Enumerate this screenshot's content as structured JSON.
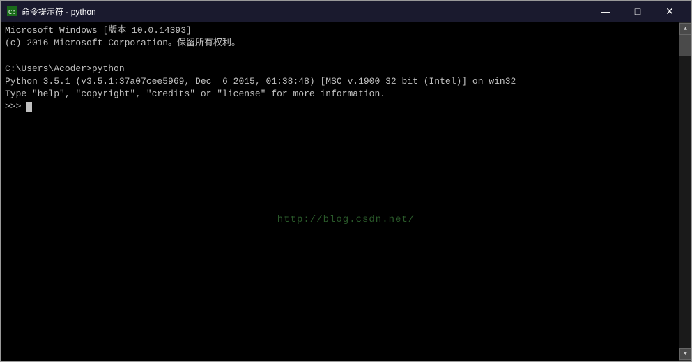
{
  "window": {
    "title_prefix": "命令提示符",
    "title_suffix": "python",
    "title_separator": " - "
  },
  "titlebar": {
    "minimize_label": "—",
    "maximize_label": "□",
    "close_label": "✕",
    "icon_text": "C"
  },
  "console": {
    "lines": [
      "Microsoft Windows [版本 10.0.14393]",
      "(c) 2016 Microsoft Corporation。保留所有权利。",
      "",
      "C:\\Users\\Acoder>python",
      "Python 3.5.1 (v3.5.1:37a07cee5969, Dec  6 2015, 01:38:48) [MSC v.1900 32 bit (Intel)] on win32",
      "Type \"help\", \"copyright\", \"credits\" or \"license\" for more information.",
      ">>> "
    ],
    "prompt": ">>> ",
    "watermark": "http://blog.csdn.net/"
  }
}
